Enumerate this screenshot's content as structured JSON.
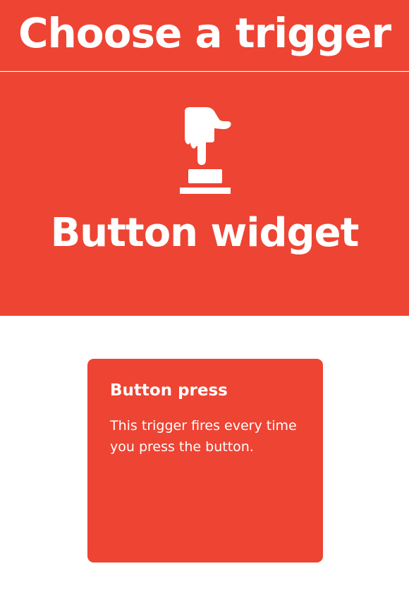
{
  "header": {
    "title": "Choose a trigger"
  },
  "hero": {
    "icon": "finger-press-button-icon",
    "service_name": "Button widget"
  },
  "triggers": [
    {
      "title": "Button press",
      "description": "This trigger fires every time you press the button."
    }
  ],
  "colors": {
    "brand": "#ee4433",
    "text": "#ffffff",
    "background": "#ffffff"
  }
}
